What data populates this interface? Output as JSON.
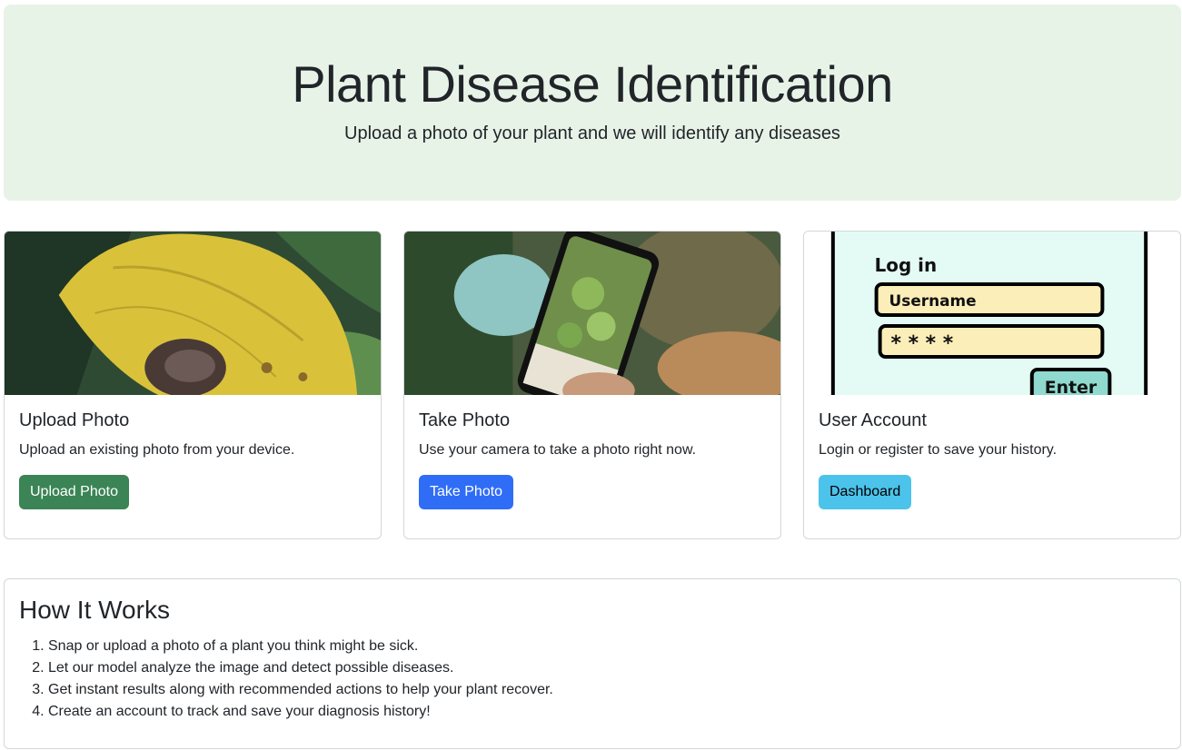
{
  "hero": {
    "title": "Plant Disease Identification",
    "subtitle": "Upload a photo of your plant and we will identify any diseases",
    "background": "#e8f3e8"
  },
  "cards": [
    {
      "title": "Upload Photo",
      "description": "Upload an existing photo from your device.",
      "button_label": "Upload Photo",
      "button_color": "#3a8455",
      "button_text_color": "#ffffff",
      "image": "yellowing-leaf-photo"
    },
    {
      "title": "Take Photo",
      "description": "Use your camera to take a photo right now.",
      "button_label": "Take Photo",
      "button_color": "#2f6df6",
      "button_text_color": "#ffffff",
      "image": "phone-camera-plant-photo"
    },
    {
      "title": "User Account",
      "description": "Login or register to save your history.",
      "button_label": "Dashboard",
      "button_color": "#4cc3ea",
      "button_text_color": "#000000",
      "image": "login-form-illustration",
      "illustration": {
        "heading": "Log in",
        "username": "Username",
        "password": "* * * *",
        "enter": "Enter"
      }
    }
  ],
  "how_it_works": {
    "title": "How It Works",
    "steps": [
      "Snap or upload a photo of a plant you think might be sick.",
      "Let our model analyze the image and detect possible diseases.",
      "Get instant results along with recommended actions to help your plant recover.",
      "Create an account to track and save your diagnosis history!"
    ]
  }
}
